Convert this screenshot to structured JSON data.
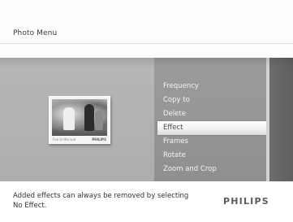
{
  "header": {
    "title": "Photo Menu"
  },
  "thumbnail": {
    "caption_left": "Fun in the sun",
    "caption_brand": "PHILIPS"
  },
  "menu": {
    "items": [
      {
        "label": "Frequency",
        "selected": false
      },
      {
        "label": "Copy to",
        "selected": false
      },
      {
        "label": "Delete",
        "selected": false
      },
      {
        "label": "Effect",
        "selected": true
      },
      {
        "label": "Frames",
        "selected": false
      },
      {
        "label": "Rotate",
        "selected": false
      },
      {
        "label": "Zoom and Crop",
        "selected": false
      }
    ]
  },
  "footer": {
    "help_line1": "Added effects can always be removed by selecting",
    "help_line2": "No Effect.",
    "brand": "PHILIPS"
  },
  "colors": {
    "background_gray": "#b3b3b3",
    "menu_column": "#979797",
    "selected_highlight": "#ffffff",
    "dark_strip": "#666666"
  }
}
